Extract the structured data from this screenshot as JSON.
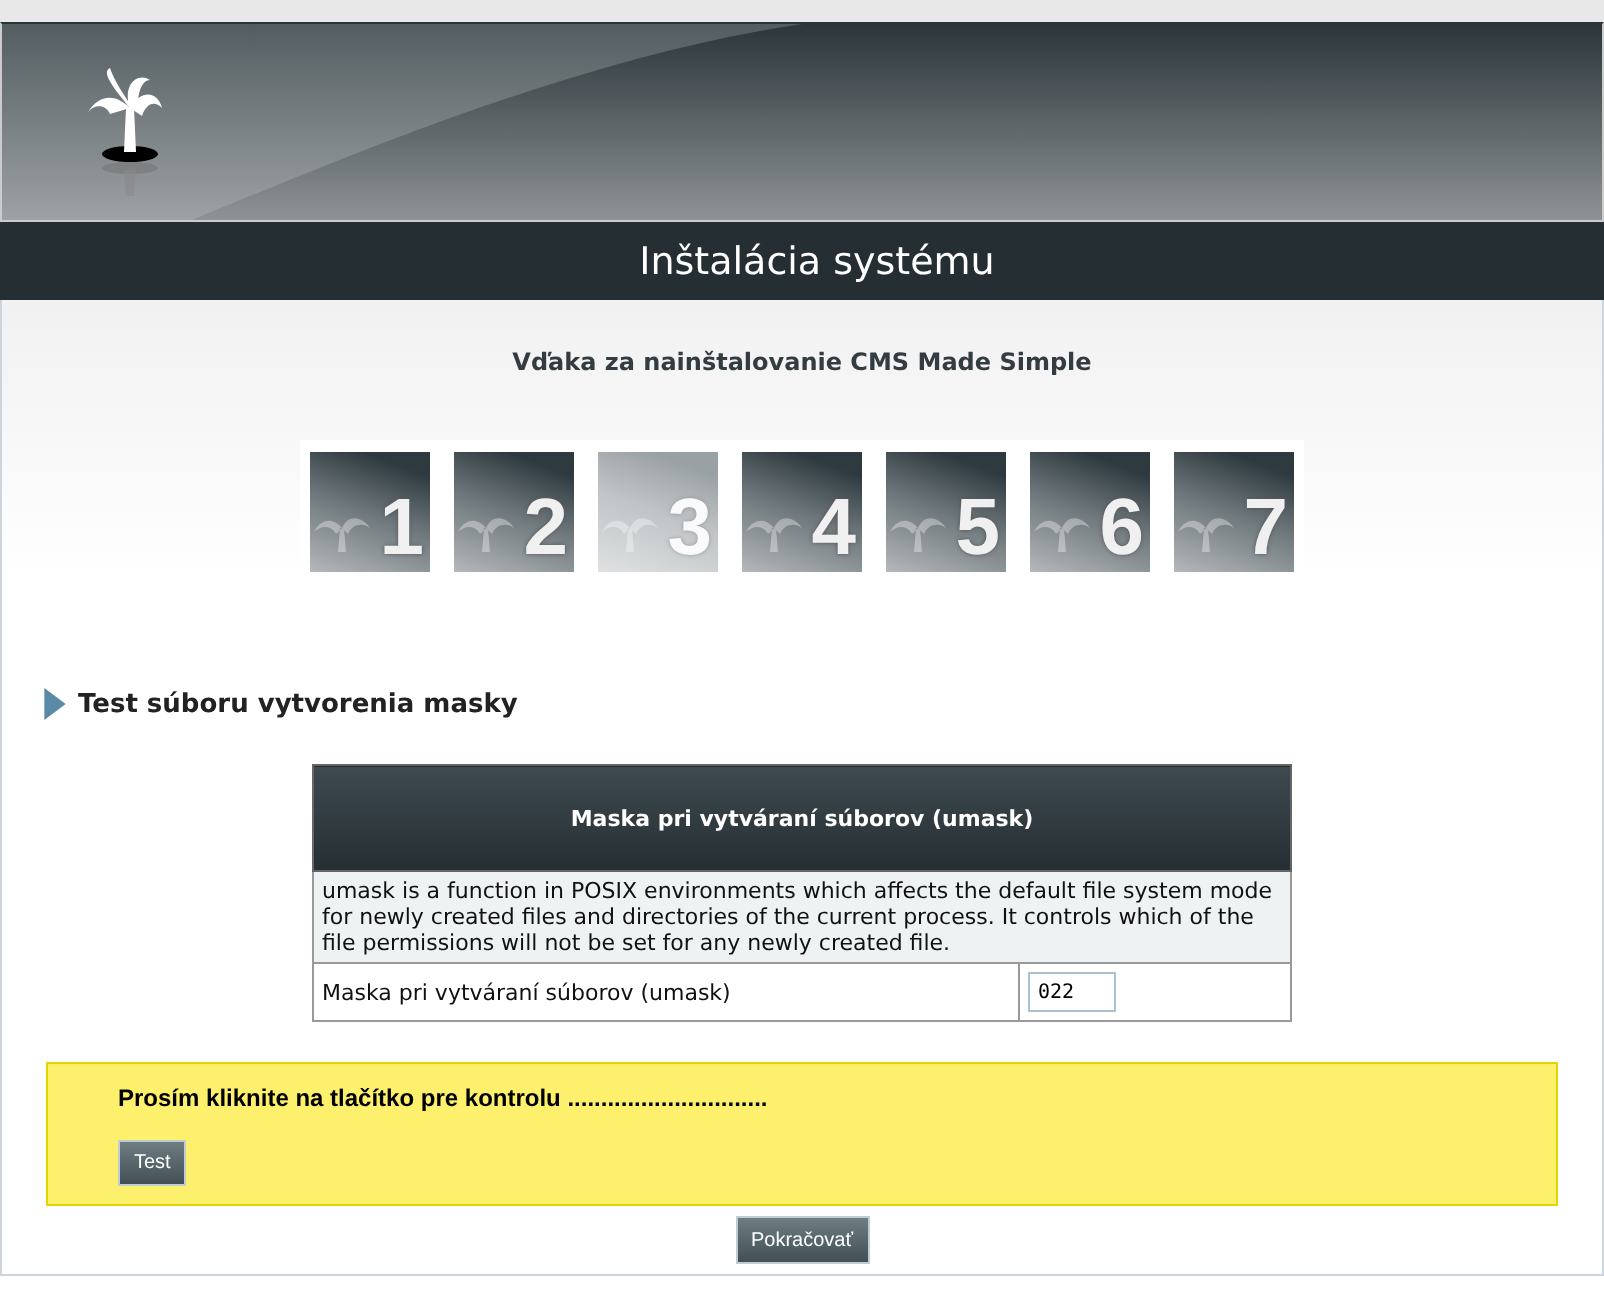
{
  "header": {
    "title": "Inštalácia systému"
  },
  "intro": "Vďaka za nainštalovanie CMS Made Simple",
  "steps": [
    {
      "label": "1",
      "selected": false
    },
    {
      "label": "2",
      "selected": false
    },
    {
      "label": "3",
      "selected": true
    },
    {
      "label": "4",
      "selected": false
    },
    {
      "label": "5",
      "selected": false
    },
    {
      "label": "6",
      "selected": false
    },
    {
      "label": "7",
      "selected": false
    }
  ],
  "section_title": "Test súboru vytvorenia masky",
  "table": {
    "heading": "Maska pri vytváraní súborov (umask)",
    "description": "umask is a function in POSIX environments which affects the default file system mode for newly created files and directories of the current process. It controls which of the file permissions will not be set for any newly created file.",
    "field_label": "Maska pri vytváraní súborov (umask)",
    "field_value": "022"
  },
  "notice": {
    "text": "Prosím kliknite na tlačítko pre kontrolu ..............................",
    "button": "Test"
  },
  "continue_button": "Pokračovať"
}
